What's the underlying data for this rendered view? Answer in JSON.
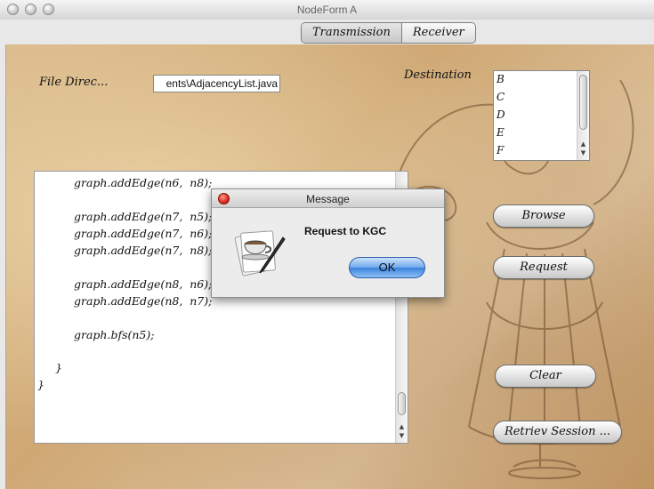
{
  "window": {
    "title": "NodeForm A"
  },
  "tabs": [
    {
      "label": "Transmission",
      "selected": true
    },
    {
      "label": "Receiver",
      "selected": false
    }
  ],
  "form": {
    "file_label": "File Direc...",
    "file_value": "ents\\AdjacencyList.java",
    "destination_label": "Destination",
    "destinations": [
      "B",
      "C",
      "D",
      "E",
      "F"
    ]
  },
  "code_lines": [
    "graph.addEdge(n6,  n8);",
    "",
    "graph.addEdge(n7,  n5);",
    "graph.addEdge(n7,  n6);",
    "graph.addEdge(n7,  n8);",
    "",
    "graph.addEdge(n8,  n6);",
    "graph.addEdge(n8,  n7);",
    "",
    "graph.bfs(n5);",
    "",
    "}",
    "}"
  ],
  "buttons": {
    "browse": "Browse",
    "request": "Request",
    "clear": "Clear",
    "retrieve": "Retriev Session ..."
  },
  "dialog": {
    "title": "Message",
    "message": "Request to KGC",
    "ok": "OK"
  },
  "colors": {
    "parchment": "#d4b080",
    "ok_button": "#5b9be8",
    "close_button": "#d9291b"
  },
  "icons": [
    "coffee-cup-icon",
    "close-icon"
  ]
}
